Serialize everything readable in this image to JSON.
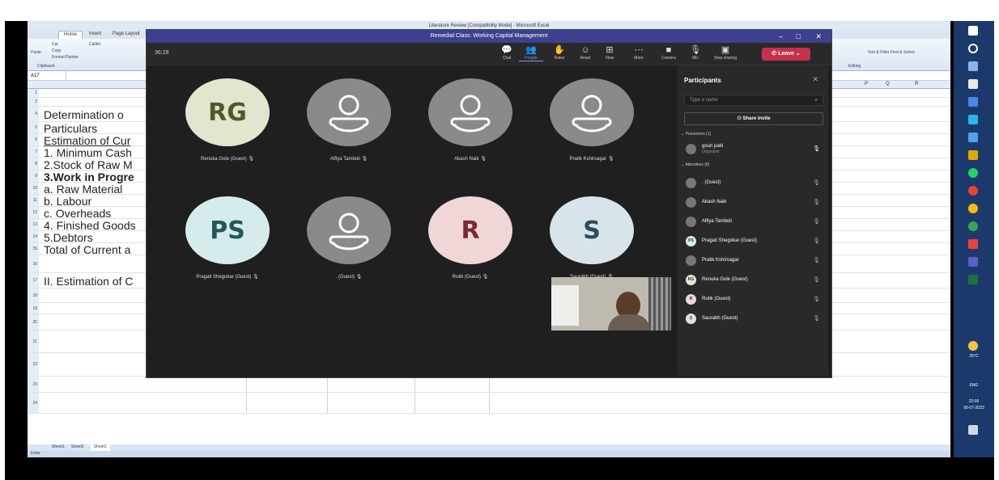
{
  "excel": {
    "title": "Literature Review [Compatibility Mode] - Microsoft Excel",
    "tabs": [
      "Home",
      "Insert",
      "Page Layout"
    ],
    "ribbon_items": [
      "Cut",
      "Copy",
      "Paste",
      "Format Painter",
      "Clipboard",
      "Calibri",
      "Sort & Filter",
      "Find & Select",
      "Editing"
    ],
    "name_box": "A17",
    "columns": [
      "A",
      "P",
      "Q",
      "R"
    ],
    "rows": [
      {
        "num": "1",
        "text": ""
      },
      {
        "num": "2",
        "text": ""
      },
      {
        "num": "4",
        "text": "Determination o"
      },
      {
        "num": "5",
        "text": "Particulars"
      },
      {
        "num": "6",
        "text": "Estimation of Cur"
      },
      {
        "num": "7",
        "text": "1. Minimum Cash"
      },
      {
        "num": "8",
        "text": "2.Stock of Raw M"
      },
      {
        "num": "9",
        "text": "3.Work in Progre"
      },
      {
        "num": "10",
        "text": "a. Raw Material"
      },
      {
        "num": "11",
        "text": "b. Labour"
      },
      {
        "num": "12",
        "text": "c. Overheads"
      },
      {
        "num": "13",
        "text": "4. Finished Goods"
      },
      {
        "num": "14",
        "text": "5.Debtors"
      },
      {
        "num": "15",
        "text": "Total of Current a"
      },
      {
        "num": "16",
        "text": ""
      },
      {
        "num": "17",
        "text": "II. Estimation of C"
      },
      {
        "num": "18",
        "text": ""
      },
      {
        "num": "19",
        "text": ""
      },
      {
        "num": "20",
        "text": ""
      },
      {
        "num": "21",
        "text": ""
      },
      {
        "num": "22",
        "text": ""
      },
      {
        "num": "23",
        "text": ""
      },
      {
        "num": "24",
        "text": ""
      }
    ],
    "sheets": [
      "Sheet1",
      "Sheet2",
      "Sheet3"
    ],
    "status": "Enter"
  },
  "taskbar": {
    "weather": "25°C",
    "lang": "ENG",
    "time": "22:06",
    "date": "06-07-2023"
  },
  "teams": {
    "title": "Remedial Class: Working Capital Management",
    "timer": "36:28",
    "toolbar": [
      {
        "icon": "💬",
        "label": "Chat"
      },
      {
        "icon": "👥",
        "label": "People"
      },
      {
        "icon": "✋",
        "label": "Raise"
      },
      {
        "icon": "☺",
        "label": "React"
      },
      {
        "icon": "⊞",
        "label": "View"
      },
      {
        "icon": "⋯",
        "label": "More"
      },
      {
        "icon": "■",
        "label": "Camera"
      },
      {
        "icon": "🎙",
        "label": "Mic"
      },
      {
        "icon": "▣",
        "label": "Stop sharing"
      }
    ],
    "leave_label": "Leave",
    "tiles": [
      {
        "initials": "RG",
        "name": "Renuka Gole (Guest)",
        "bg": "#e2e6cf",
        "fg": "#4e5a2c"
      },
      {
        "initials": "",
        "name": "Alfiya Tamboli",
        "bg": "#8a8a8a",
        "fg": "#fff"
      },
      {
        "initials": "",
        "name": "Akash Naik",
        "bg": "#8a8a8a",
        "fg": "#fff"
      },
      {
        "initials": "",
        "name": "Pratik Kshirsagar",
        "bg": "#8a8a8a",
        "fg": "#fff"
      },
      {
        "initials": "PS",
        "name": "Pragati Shegokar (Guest)",
        "bg": "#d6ecec",
        "fg": "#225859"
      },
      {
        "initials": "",
        "name": ". (Guest)",
        "bg": "#8a8a8a",
        "fg": "#fff"
      },
      {
        "initials": "R",
        "name": "Rutik (Guest)",
        "bg": "#f1d6d8",
        "fg": "#7a2a32"
      },
      {
        "initials": "S",
        "name": "Saurabh (Guest)",
        "bg": "#d9e4ea",
        "fg": "#2b4d5e"
      }
    ],
    "panel": {
      "title": "Participants",
      "search_placeholder": "Type a name",
      "share_label": "Share invite",
      "presenters_label": "Presenters (1)",
      "attendees_label": "Attendees (8)",
      "presenter": {
        "name": "gouri patil",
        "role": "Organizer"
      },
      "attendees": [
        {
          "initials": "",
          "name": ". (Guest)"
        },
        {
          "initials": "",
          "name": "Akash Naik"
        },
        {
          "initials": "",
          "name": "Alfiya Tamboli"
        },
        {
          "initials": "PS",
          "name": "Pragati Shegokar (Guest)"
        },
        {
          "initials": "",
          "name": "Pratik Kshirsagar"
        },
        {
          "initials": "RG",
          "name": "Renuka Gole (Guest)"
        },
        {
          "initials": "R",
          "name": "Rutik (Guest)"
        },
        {
          "initials": "S",
          "name": "Saurabh (Guest)"
        }
      ]
    }
  }
}
